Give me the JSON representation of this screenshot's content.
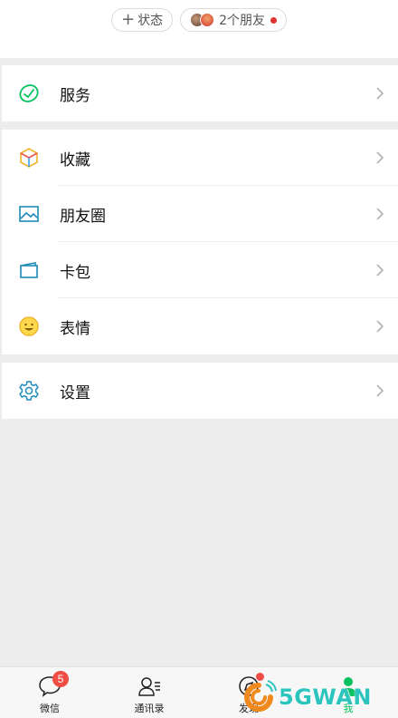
{
  "status_bar": {
    "add_status_label": "状态",
    "friends_label": "2个朋友"
  },
  "menu": {
    "services": "服务",
    "favorites": "收藏",
    "moments": "朋友圈",
    "cards": "卡包",
    "stickers": "表情",
    "settings": "设置"
  },
  "tabs": {
    "chats": "微信",
    "chats_badge": "5",
    "contacts": "通讯录",
    "discover": "发现",
    "me": "我"
  },
  "watermark": {
    "text": "5GWAN"
  },
  "colors": {
    "wechat_green": "#07c160",
    "badge_red": "#f04e45",
    "icon_blue": "#1e8ab8",
    "watermark_teal": "#2cc4bd",
    "watermark_orange": "#f08a1d"
  }
}
